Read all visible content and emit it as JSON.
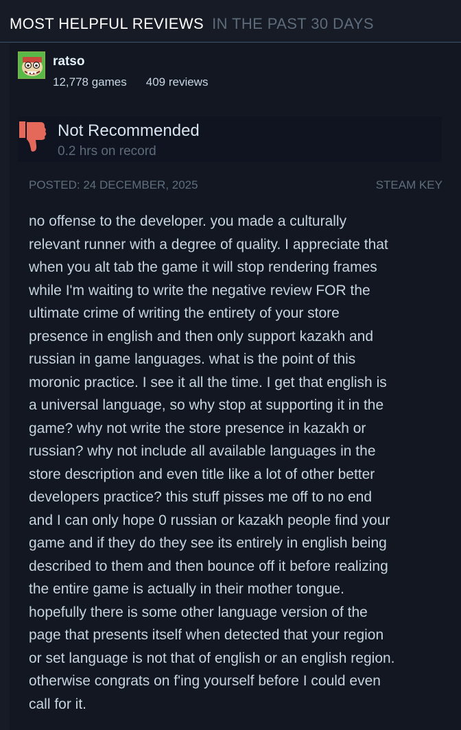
{
  "header": {
    "title": "MOST HELPFUL REVIEWS",
    "subtitle": "IN THE PAST 30 DAYS"
  },
  "reviewer": {
    "name": "ratso",
    "games": "12,778 games",
    "reviews": "409 reviews",
    "avatar_icon": "cartoon-face-avatar-icon"
  },
  "review": {
    "verdict": "Not Recommended",
    "verdict_icon": "thumbs-down-icon",
    "hours": "0.2 hrs on record",
    "posted": "POSTED: 24 DECEMBER, 2025",
    "source": "STEAM KEY",
    "text_lines": [
      "no offense to the developer. you made a culturally",
      "relevant runner with a degree of quality. I appreciate that",
      "when you alt tab the game it will stop rendering frames",
      "while I'm waiting to write the negative review FOR the",
      "ultimate crime of writing the entirety of your store",
      "presence in english and then only support kazakh and",
      "russian in game languages. what is the point of this",
      "moronic practice. I see it all the time. I get that english is",
      "a universal language, so why stop at supporting it in the",
      "game? why not write the store presence in kazakh or",
      "russian? why not include all available languages in the",
      "store description and even title like a lot of other better",
      "developers practice? this stuff pisses me off to no end",
      "and I can only hope 0 russian or kazakh people find your",
      "game and if they do they see its entirely in english being",
      "described to them and then bounce off it before realizing",
      "the entire game is actually in their mother tongue.",
      "hopefully there is some other language version of the",
      "page that presents itself when detected that your region",
      "or set language is not that of english or an english region.",
      "otherwise congrats on f'ing yourself before I could even",
      "call for it."
    ]
  },
  "colors": {
    "background": "#161b25",
    "panel": "#121721",
    "vote_box": "#0f1420",
    "thumbs_down": "#e5695b",
    "text": "#c6d4df",
    "muted": "#5f6e7d"
  }
}
